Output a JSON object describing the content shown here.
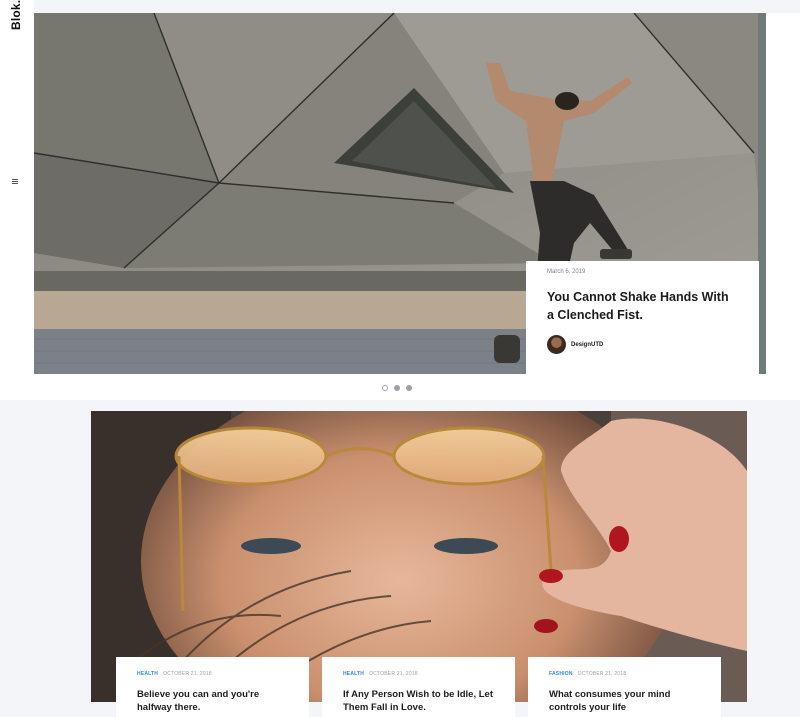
{
  "brand": {
    "logo_text": "Blok."
  },
  "nav": {
    "menu_icon": "hamburger-icon"
  },
  "hero": {
    "image_alt": "",
    "date": "March 6, 2019",
    "title": "You Cannot Shake Hands With a Clenched Fist.",
    "author": {
      "name": "DesignUTD"
    }
  },
  "slider": {
    "count": 3,
    "active_index": 0
  },
  "featured": {
    "image_alt": ""
  },
  "posts": [
    {
      "category": "HEALTH",
      "date": "OCTOBER 21, 2018",
      "title": "Believe you can and you're halfway there."
    },
    {
      "category": "HEALTH",
      "date": "OCTOBER 21, 2018",
      "title": "If Any Person Wish to be Idle, Let Them Fall in Love."
    },
    {
      "category": "FASHION",
      "date": "OCTOBER 21, 2018",
      "title": "What consumes your mind controls your life"
    }
  ],
  "colors": {
    "accent": "#2f86e6",
    "background": "#f3f5f9",
    "card": "#ffffff"
  }
}
